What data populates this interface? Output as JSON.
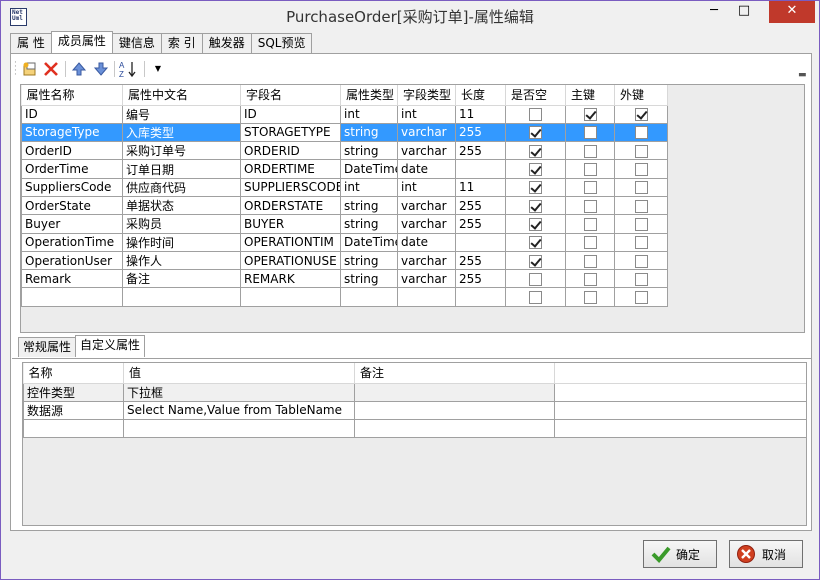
{
  "window": {
    "title": "PurchaseOrder[采购订单]-属性编辑",
    "icon_text": "Net\nUml",
    "minimize": "─",
    "maximize": "□",
    "close": "✕"
  },
  "tabs": [
    "属 性",
    "成员属性",
    "键信息",
    "索 引",
    "触发器",
    "SQL预览"
  ],
  "active_tab": 1,
  "toolbar": {
    "icons": [
      "add-field-icon",
      "delete-icon",
      "move-up-icon",
      "move-down-icon",
      "sort-az-icon",
      "dropdown-icon"
    ],
    "colors": {
      "delete": "#e03020",
      "arrows": "#4a78c8"
    }
  },
  "member_grid": {
    "columns": [
      "属性名称",
      "属性中文名",
      "字段名",
      "属性类型",
      "字段类型",
      "长度",
      "是否空",
      "主键",
      "外键"
    ],
    "rows": [
      {
        "name": "ID",
        "cn": "编号",
        "field": "ID",
        "ptype": "int",
        "ftype": "int",
        "len": "11",
        "nullable": false,
        "pk": true,
        "fk": true
      },
      {
        "name": "StorageType",
        "cn": "入库类型",
        "field": "STORAGETYPE",
        "ptype": "string",
        "ftype": "varchar",
        "len": "255",
        "nullable": true,
        "pk": false,
        "fk": false,
        "selected": true
      },
      {
        "name": "OrderID",
        "cn": "采购订单号",
        "field": "ORDERID",
        "ptype": "string",
        "ftype": "varchar",
        "len": "255",
        "nullable": true,
        "pk": false,
        "fk": false
      },
      {
        "name": "OrderTime",
        "cn": "订单日期",
        "field": "ORDERTIME",
        "ptype": "DateTime",
        "ftype": "date",
        "len": "",
        "nullable": true,
        "pk": false,
        "fk": false
      },
      {
        "name": "SuppliersCode",
        "cn": "供应商代码",
        "field": "SUPPLIERSCODE",
        "ptype": "int",
        "ftype": "int",
        "len": "11",
        "nullable": true,
        "pk": false,
        "fk": false
      },
      {
        "name": "OrderState",
        "cn": "单据状态",
        "field": "ORDERSTATE",
        "ptype": "string",
        "ftype": "varchar",
        "len": "255",
        "nullable": true,
        "pk": false,
        "fk": false
      },
      {
        "name": "Buyer",
        "cn": "采购员",
        "field": "BUYER",
        "ptype": "string",
        "ftype": "varchar",
        "len": "255",
        "nullable": true,
        "pk": false,
        "fk": false
      },
      {
        "name": "OperationTime",
        "cn": "操作时间",
        "field": "OPERATIONTIM",
        "ptype": "DateTime",
        "ftype": "date",
        "len": "",
        "nullable": true,
        "pk": false,
        "fk": false
      },
      {
        "name": "OperationUser",
        "cn": "操作人",
        "field": "OPERATIONUSE",
        "ptype": "string",
        "ftype": "varchar",
        "len": "255",
        "nullable": true,
        "pk": false,
        "fk": false
      },
      {
        "name": "Remark",
        "cn": "备注",
        "field": "REMARK",
        "ptype": "string",
        "ftype": "varchar",
        "len": "255",
        "nullable": false,
        "pk": false,
        "fk": false
      },
      {
        "name": "",
        "cn": "",
        "field": "",
        "ptype": "",
        "ftype": "",
        "len": "",
        "nullable": false,
        "pk": false,
        "fk": false
      }
    ]
  },
  "subtabs": [
    "常规属性",
    "自定义属性"
  ],
  "active_subtab": 1,
  "custom_grid": {
    "columns": [
      "名称",
      "值",
      "备注",
      ""
    ],
    "rows": [
      [
        "控件类型",
        "下拉框",
        "",
        ""
      ],
      [
        "数据源",
        "Select Name,Value from TableName",
        "",
        ""
      ],
      [
        "",
        "",
        "",
        ""
      ]
    ]
  },
  "buttons": {
    "ok": "确定",
    "cancel": "取消"
  },
  "colors": {
    "selection": "#3399ff",
    "close_button": "#c0392b",
    "ok_icon": "#3a9a2a",
    "cancel_icon": "#d04020"
  }
}
